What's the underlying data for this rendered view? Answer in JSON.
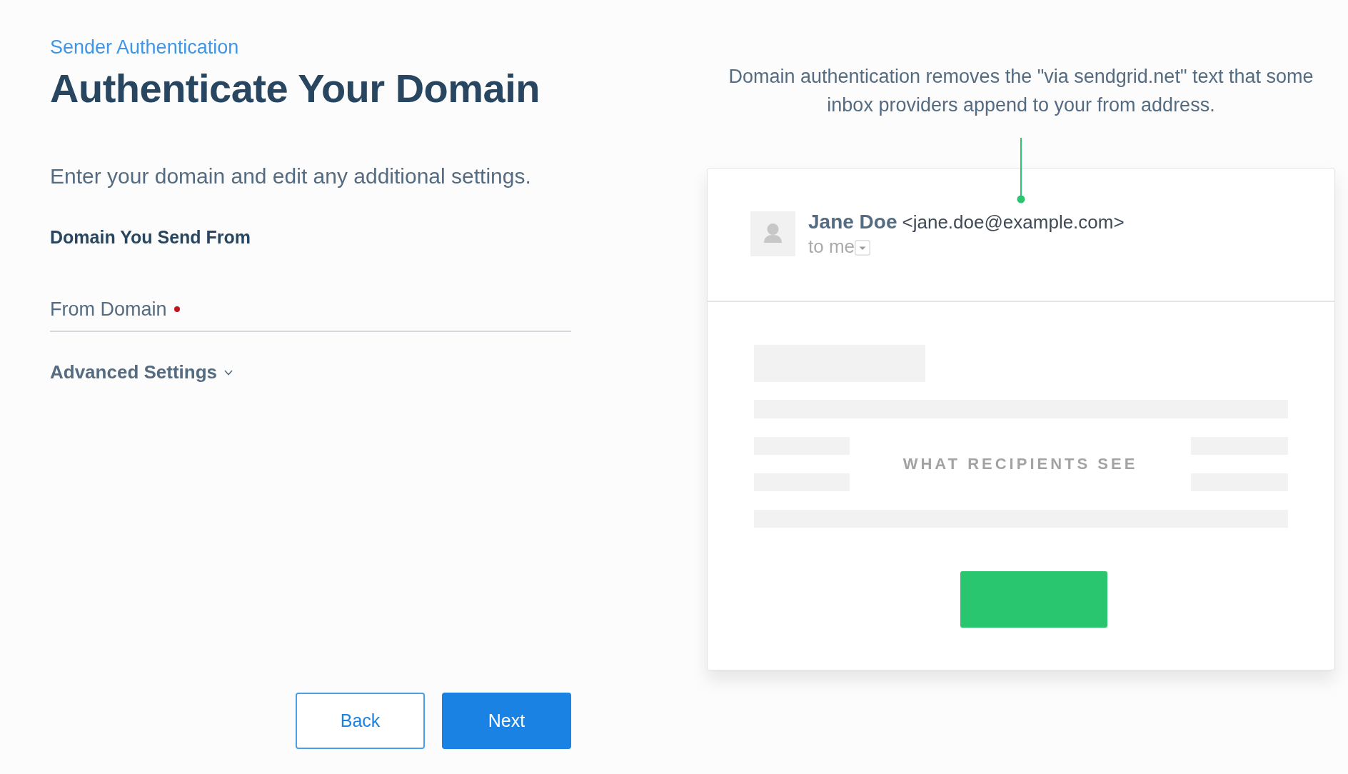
{
  "breadcrumb": "Sender Authentication",
  "title": "Authenticate Your Domain",
  "intro": "Enter your domain and edit any additional settings.",
  "section_heading": "Domain You Send From",
  "from_domain_field": {
    "label": "From Domain",
    "required": true
  },
  "advanced_settings": {
    "label": "Advanced Settings",
    "expanded": false
  },
  "buttons": [
    {
      "label": "Back",
      "kind": "secondary"
    },
    {
      "label": "Next",
      "kind": "primary"
    }
  ],
  "preview": {
    "caption": "Domain authentication removes the \"via sendgrid.net\" text that some inbox providers append to your from address.",
    "sender_name": "Jane Doe",
    "sender_address": "<jane.doe@example.com>",
    "recipient": "to me",
    "overlay_label": "WHAT RECIPIENTS SEE"
  }
}
